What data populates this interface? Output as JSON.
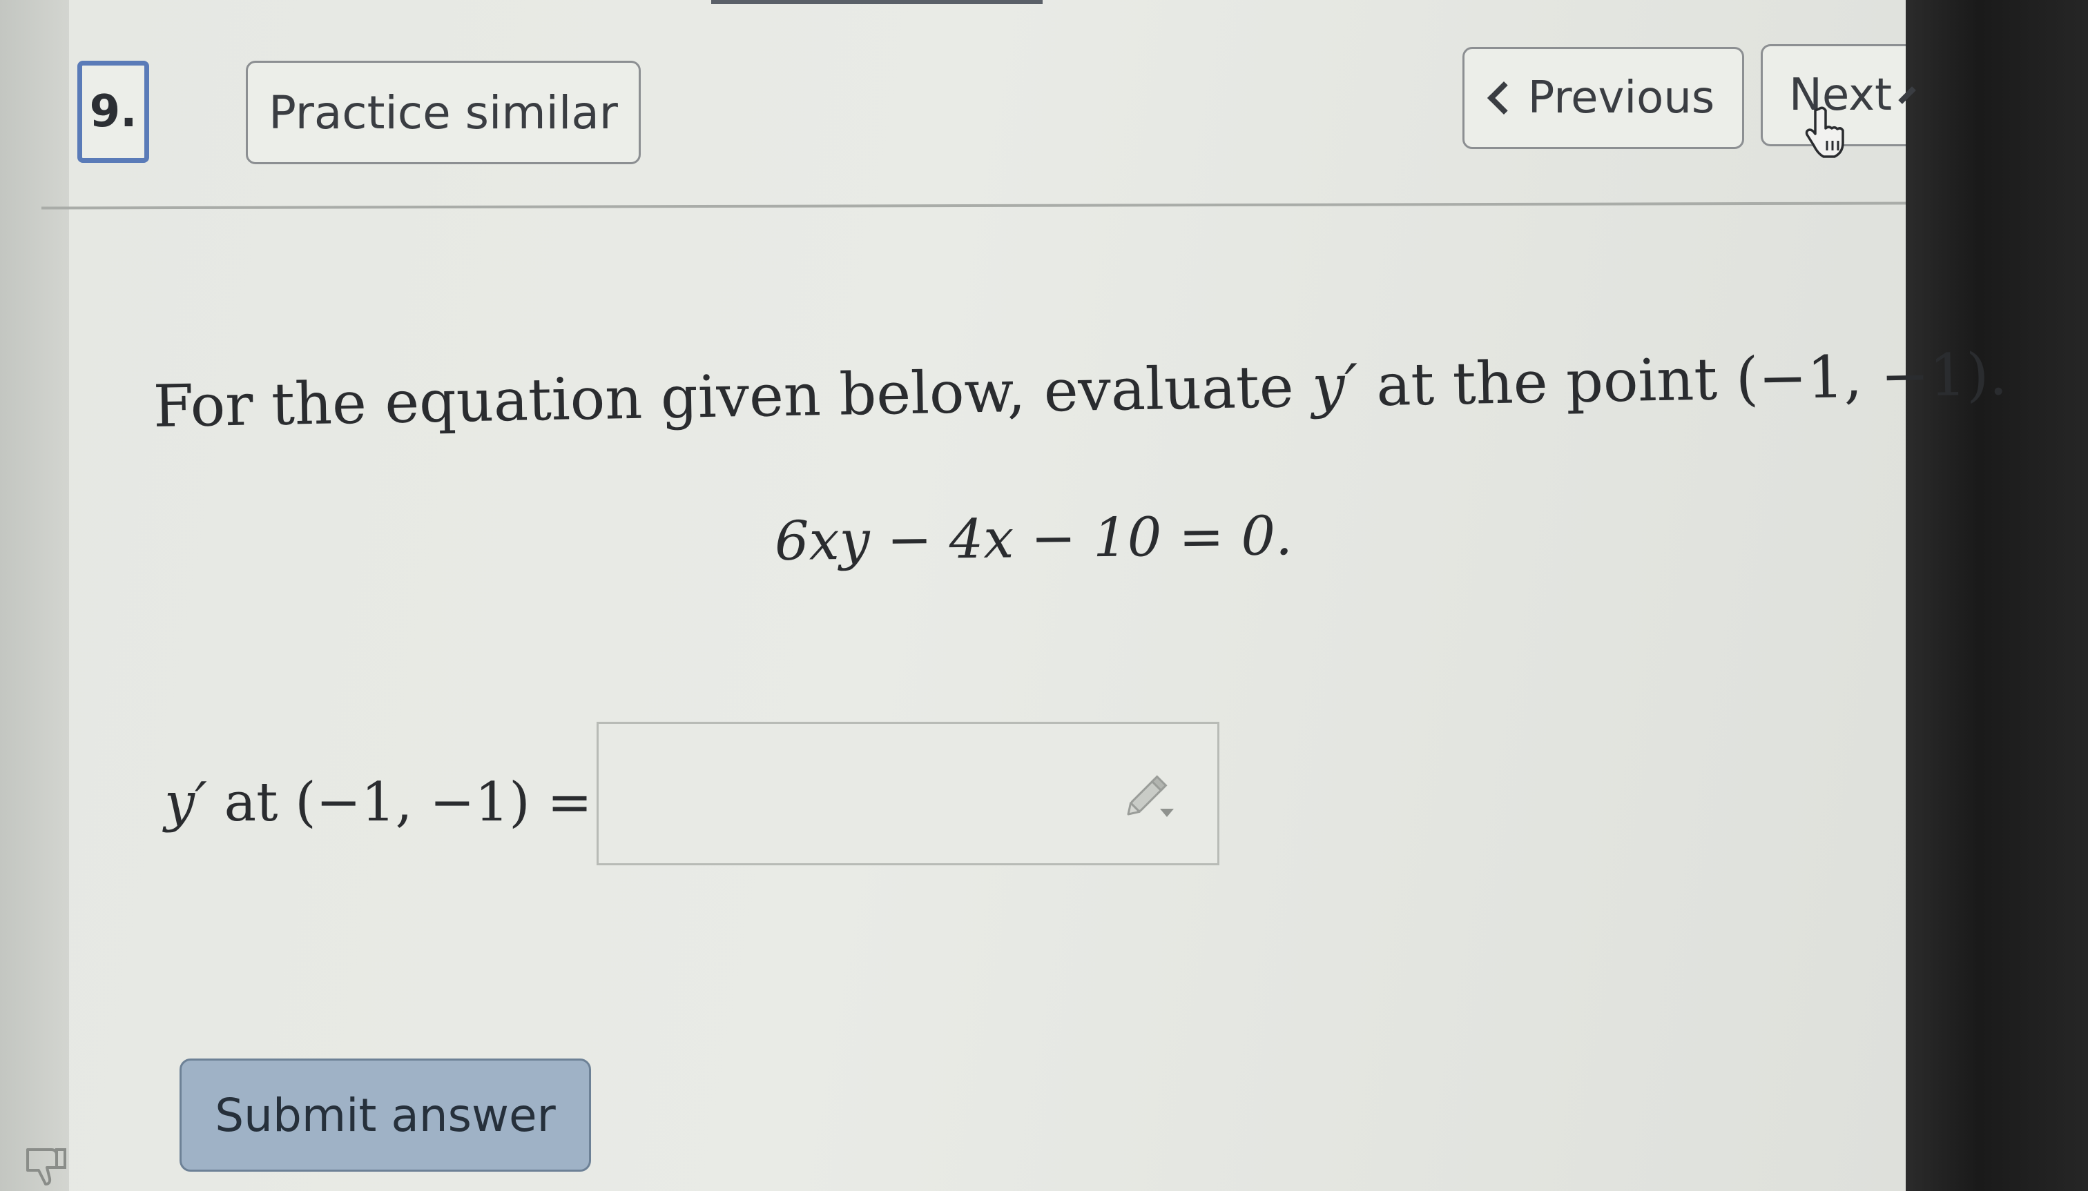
{
  "header": {
    "question_number": "9.",
    "practice_label": "Practice similar",
    "previous_label": "Previous",
    "next_label": "Next"
  },
  "question": {
    "prompt_before": "For the equation given below, evaluate ",
    "prompt_var": "y′",
    "prompt_after": " at the point (−1, −1).",
    "equation": "6xy − 4x − 10 = 0."
  },
  "answer": {
    "label_var": "y′",
    "label_rest": " at (−1, −1) =",
    "value": ""
  },
  "actions": {
    "submit_label": "Submit answer"
  },
  "icons": {
    "previous": "chevron-left-icon",
    "next": "chevron-right-icon",
    "cursor": "hand-pointer-icon",
    "math_editor": "pencil-icon",
    "feedback": "thumbs-down-icon"
  },
  "colors": {
    "question_number_border": "#5a7bb8",
    "submit_bg": "#9fb2c6",
    "text": "#2a2c2f"
  }
}
